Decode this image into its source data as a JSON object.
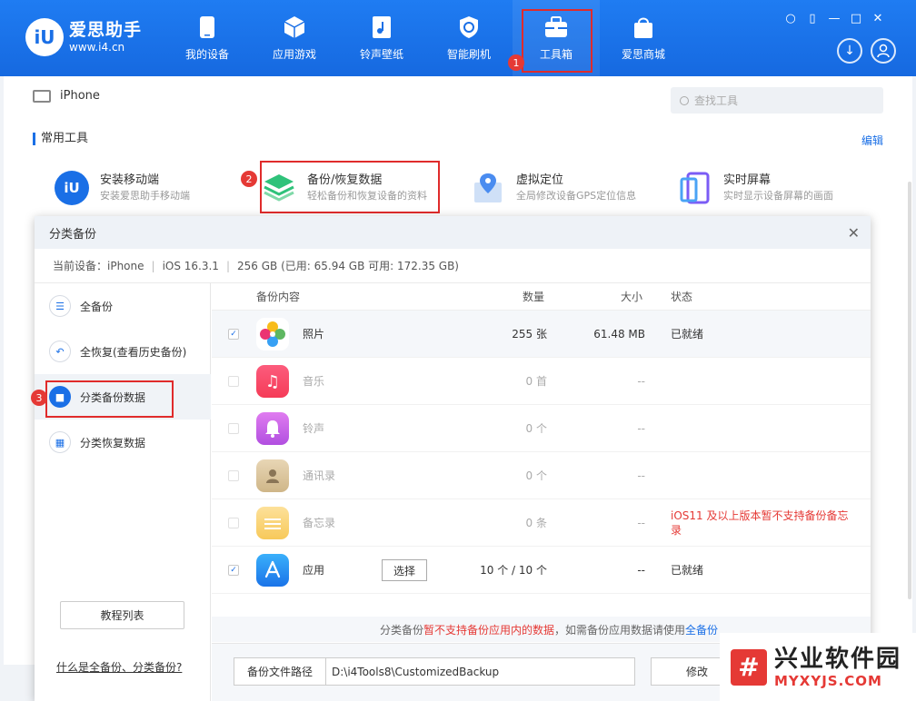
{
  "app": {
    "logo_name": "爱思助手",
    "logo_url": "www.i4.cn",
    "logo_mark": "iU"
  },
  "nav": [
    {
      "label": "我的设备",
      "icon": "phone-icon"
    },
    {
      "label": "应用游戏",
      "icon": "cube-icon"
    },
    {
      "label": "铃声壁纸",
      "icon": "music-file-icon"
    },
    {
      "label": "智能刷机",
      "icon": "shield-refresh-icon"
    },
    {
      "label": "工具箱",
      "icon": "toolbox-icon"
    },
    {
      "label": "爱思商城",
      "icon": "shopping-bag-icon"
    }
  ],
  "steps": [
    "1",
    "2",
    "3"
  ],
  "window_controls": [
    "shirt-icon",
    "note-icon",
    "minimize-icon",
    "maximize-icon",
    "close-icon"
  ],
  "main": {
    "device": "iPhone",
    "search_placeholder": "查找工具",
    "section_title": "常用工具",
    "edit": "编辑",
    "tools": [
      {
        "title": "安装移动端",
        "desc": "安装爱思助手移动端"
      },
      {
        "title": "备份/恢复数据",
        "desc": "轻松备份和恢复设备的资料"
      },
      {
        "title": "虚拟定位",
        "desc": "全局修改设备GPS定位信息"
      },
      {
        "title": "实时屏幕",
        "desc": "实时显示设备屏幕的画面"
      }
    ]
  },
  "dialog": {
    "title": "分类备份",
    "info": {
      "device": "当前设备：iPhone",
      "ios": "iOS 16.3.1",
      "storage": "256 GB (已用: 65.94 GB 可用: 172.35 GB)"
    },
    "sidebar": [
      {
        "label": "全备份"
      },
      {
        "label": "全恢复(查看历史备份)"
      },
      {
        "label": "分类备份数据"
      },
      {
        "label": "分类恢复数据"
      }
    ],
    "tutorial_button": "教程列表",
    "help_link": "什么是全备份、分类备份?",
    "columns": {
      "content": "备份内容",
      "count": "数量",
      "size": "大小",
      "status": "状态"
    },
    "rows": [
      {
        "name": "照片",
        "count": "255 张",
        "size": "61.48 MB",
        "status": "已就绪",
        "checked": "✓"
      },
      {
        "name": "音乐",
        "count": "0 首",
        "size": "--",
        "status": "",
        "checked": ""
      },
      {
        "name": "铃声",
        "count": "0 个",
        "size": "--",
        "status": "",
        "checked": ""
      },
      {
        "name": "通讯录",
        "count": "0 个",
        "size": "--",
        "status": "",
        "checked": ""
      },
      {
        "name": "备忘录",
        "count": "0 条",
        "size": "--",
        "status": "iOS11 及以上版本暂不支持备份备忘录",
        "checked": ""
      },
      {
        "name": "应用",
        "count": "10 个 / 10 个",
        "size": "--",
        "status": "已就绪",
        "checked": "✓",
        "button": "选择"
      }
    ],
    "note": {
      "part1": "分类备份 ",
      "part2": "暂不支持备份应用内的数据",
      "part3": "，如需备份应用数据请使用 ",
      "part4": "全备份"
    },
    "footer": {
      "path_label": "备份文件路径",
      "path_value": "D:\\i4Tools8\\CustomizedBackup",
      "modify": "修改"
    }
  },
  "watermark": {
    "cn": "兴业软件园",
    "en": "MYXYJS.COM",
    "mark": "#"
  }
}
